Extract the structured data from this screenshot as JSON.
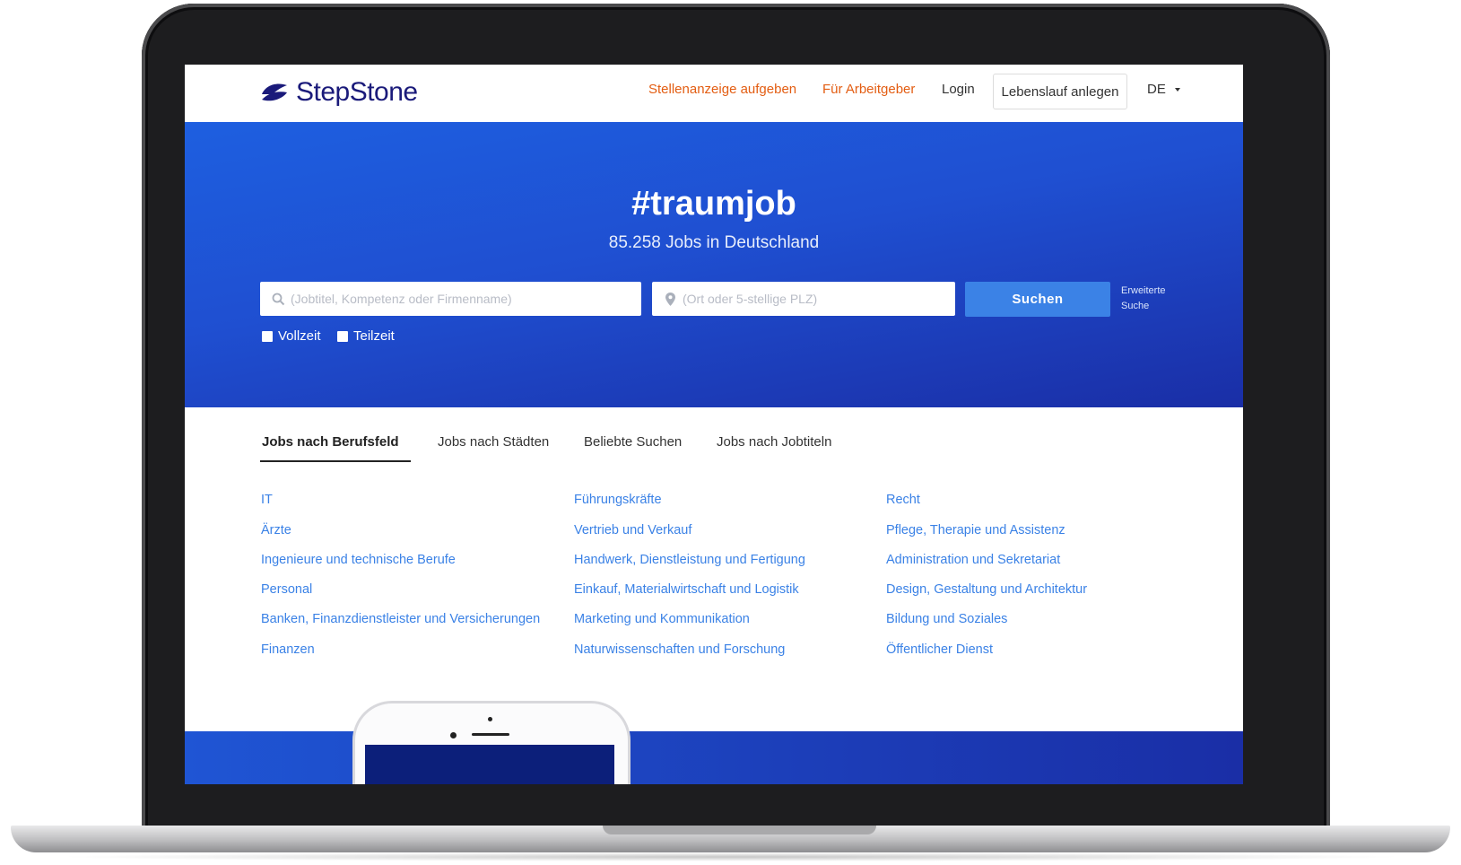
{
  "brand": {
    "name": "StepStone",
    "accent": "#3b82e6",
    "brand_blue": "#1a1a7a",
    "orange": "#e35d12"
  },
  "header": {
    "post_job": "Stellenanzeige aufgeben",
    "employers": "Für Arbeitgeber",
    "login": "Login",
    "create_cv": "Lebenslauf anlegen",
    "language": "DE"
  },
  "hero": {
    "title": "#traumjob",
    "subtitle": "85.258 Jobs in Deutschland",
    "job_placeholder": "(Jobtitel, Kompetenz oder Firmenname)",
    "location_placeholder": "(Ort oder 5-stellige PLZ)",
    "search_label": "Suchen",
    "advanced_line1": "Erweiterte",
    "advanced_line2": "Suche",
    "filters": [
      "Vollzeit",
      "Teilzeit"
    ]
  },
  "tabs": [
    "Jobs nach Berufsfeld",
    "Jobs nach Städten",
    "Beliebte Suchen",
    "Jobs nach Jobtiteln"
  ],
  "categories": {
    "col1": [
      "IT",
      "Ärzte",
      "Ingenieure und technische Berufe",
      "Personal",
      "Banken, Finanzdienstleister und Versicherungen",
      "Finanzen"
    ],
    "col2": [
      "Führungskräfte",
      "Vertrieb und Verkauf",
      "Handwerk, Dienstleistung und Fertigung",
      "Einkauf, Materialwirtschaft und Logistik",
      "Marketing und Kommunikation",
      "Naturwissenschaften und Forschung"
    ],
    "col3": [
      "Recht",
      "Pflege, Therapie und Assistenz",
      "Administration und Sekretariat",
      "Design, Gestaltung und Architektur",
      "Bildung und Soziales",
      "Öffentlicher Dienst"
    ]
  }
}
